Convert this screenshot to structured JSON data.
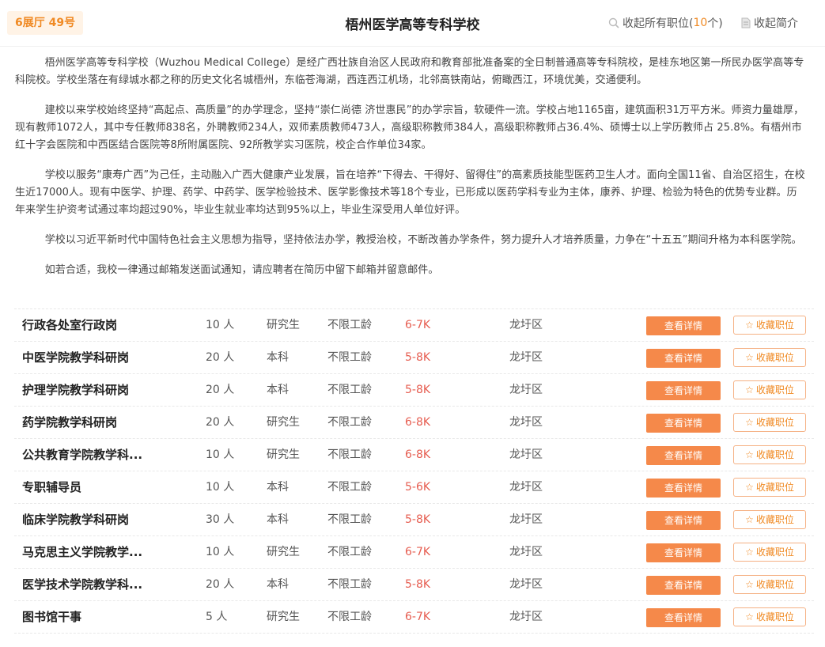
{
  "header": {
    "booth": "6展厅 49号",
    "title": "梧州医学高等专科学校",
    "collapse_positions_prefix": "收起所有职位(",
    "collapse_positions_count": "10",
    "collapse_positions_suffix": "个)",
    "collapse_intro": "收起简介"
  },
  "intro": [
    "梧州医学高等专科学校（Wuzhou Medical College）是经广西壮族自治区人民政府和教育部批准备案的全日制普通高等专科院校，是桂东地区第一所民办医学高等专科院校。学校坐落在有绿城水都之称的历史文化名城梧州，东临苍海湖，西连西江机场，北邻高铁南站，俯瞰西江，环境优美，交通便利。",
    "建校以来学校始终坚持“高起点、高质量”的办学理念，坚持“崇仁尚德 济世惠民”的办学宗旨，软硬件一流。学校占地1165亩，建筑面积31万平方米。师资力量雄厚，现有教师1072人，其中专任教师838名，外聘教师234人，双师素质教师473人，高级职称教师384人，高级职称教师占36.4%、硕博士以上学历教师占 25.8%。有梧州市红十字会医院和中西医结合医院等8所附属医院、92所教学实习医院，校企合作单位34家。",
    "学校以服务“康寿广西”为己任，主动融入广西大健康产业发展，旨在培养“下得去、干得好、留得住”的高素质技能型医药卫生人才。面向全国11省、自治区招生，在校生近17000人。现有中医学、护理、药学、中药学、医学检验技术、医学影像技术等18个专业，已形成以医药学科专业为主体，康养、护理、检验为特色的优势专业群。历年来学生护资考试通过率均超过90%，毕业生就业率均达到95%以上，毕业生深受用人单位好评。",
    "学校以习近平新时代中国特色社会主义思想为指导，坚持依法办学，教授治校，不断改善办学条件，努力提升人才培养质量，力争在“十五五”期间升格为本科医学院。",
    "如若合适，我校一律通过邮箱发送面试通知，请应聘者在简历中留下邮箱并留意邮件。"
  ],
  "buttons": {
    "detail": "查看详情",
    "favorite": "收藏职位"
  },
  "jobs": [
    {
      "name": "行政各处室行政岗",
      "count": "10 人",
      "education": "研究生",
      "experience": "不限工龄",
      "salary": "6-7K",
      "location": "龙圩区"
    },
    {
      "name": "中医学院教学科研岗",
      "count": "20 人",
      "education": "本科",
      "experience": "不限工龄",
      "salary": "5-8K",
      "location": "龙圩区"
    },
    {
      "name": "护理学院教学科研岗",
      "count": "20 人",
      "education": "本科",
      "experience": "不限工龄",
      "salary": "5-8K",
      "location": "龙圩区"
    },
    {
      "name": "药学院教学科研岗",
      "count": "20 人",
      "education": "研究生",
      "experience": "不限工龄",
      "salary": "6-8K",
      "location": "龙圩区"
    },
    {
      "name": "公共教育学院教学科...",
      "count": "10 人",
      "education": "研究生",
      "experience": "不限工龄",
      "salary": "6-8K",
      "location": "龙圩区"
    },
    {
      "name": "专职辅导员",
      "count": "10 人",
      "education": "本科",
      "experience": "不限工龄",
      "salary": "5-6K",
      "location": "龙圩区"
    },
    {
      "name": "临床学院教学科研岗",
      "count": "30 人",
      "education": "本科",
      "experience": "不限工龄",
      "salary": "5-8K",
      "location": "龙圩区"
    },
    {
      "name": "马克思主义学院教学...",
      "count": "10 人",
      "education": "研究生",
      "experience": "不限工龄",
      "salary": "6-7K",
      "location": "龙圩区"
    },
    {
      "name": "医学技术学院教学科...",
      "count": "20 人",
      "education": "本科",
      "experience": "不限工龄",
      "salary": "5-8K",
      "location": "龙圩区"
    },
    {
      "name": "图书馆干事",
      "count": "5 人",
      "education": "研究生",
      "experience": "不限工龄",
      "salary": "6-7K",
      "location": "龙圩区"
    }
  ],
  "colors": {
    "accent": "#f5894a",
    "salary": "#e65c4f",
    "booth_bg": "#fff3e6"
  },
  "icons": {
    "search": "search-icon",
    "document": "document-icon",
    "star": "star-icon"
  }
}
